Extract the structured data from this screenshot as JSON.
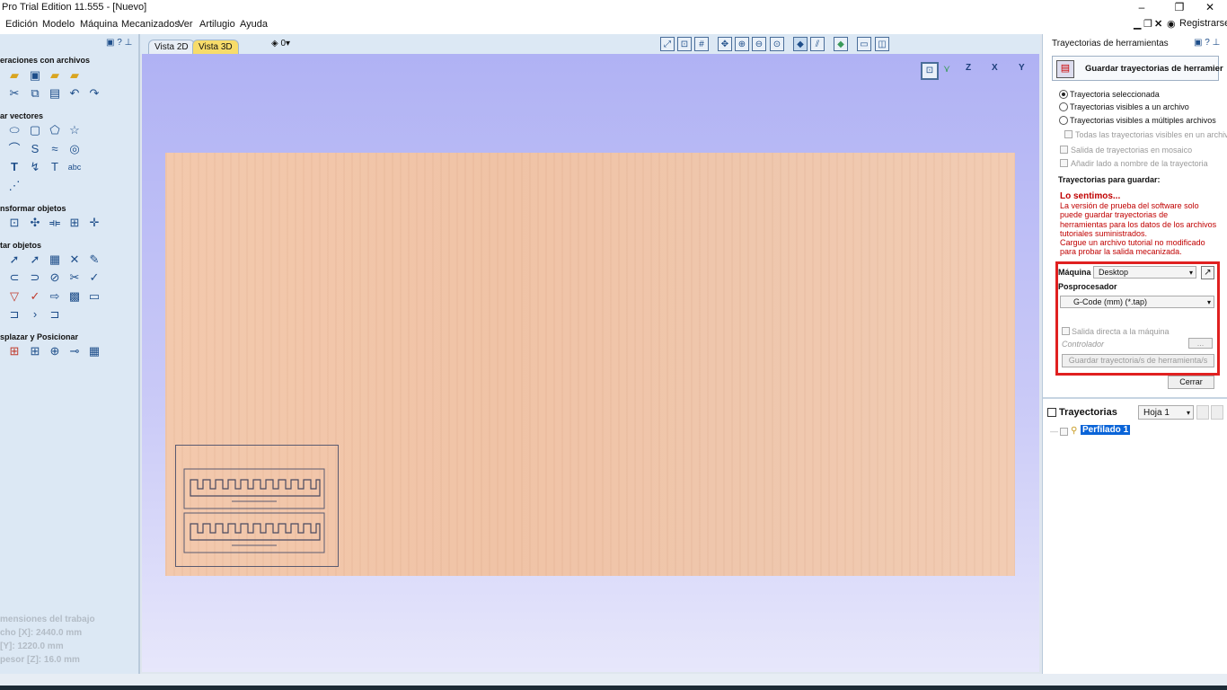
{
  "window": {
    "title": "Pro Trial Edition 11.555 - [Nuevo]"
  },
  "menu": {
    "items": [
      "Edición",
      "Modelo",
      "Máquina",
      "Mecanizados",
      "Ver",
      "Artilugio",
      "Ayuda"
    ],
    "register": "Registrarse..."
  },
  "left_panel": {
    "sections": [
      "eraciones con archivos",
      "ar vectores",
      "nsformar objetos",
      "tar objetos",
      "splazar y Posicionar"
    ],
    "dims": {
      "title": "mensiones del trabajo",
      "width": "cho   [X]: 2440.0 mm",
      "height": "    [Y]: 1220.0 mm",
      "thickness": "pesor [Z]: 16.0 mm"
    }
  },
  "view": {
    "tab_2d": "Vista 2D",
    "tab_3d": "Vista 3D",
    "layer_value": "0",
    "axes": [
      "Z",
      "X",
      "Y"
    ]
  },
  "right_panel": {
    "title": "Trayectorias de herramientas",
    "save_button": "Guardar trayectorias de herramier",
    "radio_selected": "Trayectoria seleccionada",
    "radio_visible_one": "Trayectorias visibles a un archivo",
    "radio_visible_multi": "Trayectorias visibles a múltiples archivos",
    "chk_all_visible": "Todas las trayectorias visibles en un archivo",
    "chk_tiled": "Salida de trayectorias en mosaico",
    "chk_append_name": "Añadir lado a nombre de la trayectoria",
    "save_heading": "Trayectorias para guardar:",
    "sorry_title": "Lo sentimos...",
    "sorry_lines": [
      "La versión de prueba del software solo",
      "puede guardar trayectorias de",
      "herramientas para los datos de los archivos",
      "tutoriales suministrados.",
      "Cargue un archivo tutorial no modificado",
      "para probar la salida mecanizada."
    ],
    "machine_label": "Máquina",
    "machine_value": "Desktop",
    "postproc_label": "Posprocesador",
    "postproc_value": "G-Code (mm) (*.tap)",
    "direct_output": "Salida directa a la máquina",
    "controller_label": "Controlador",
    "controller_btn": "...",
    "save_toolpaths_btn": "Guardar trayectoria/s de herramienta/s",
    "close_btn": "Cerrar",
    "toolpaths_title": "Trayectorias",
    "sheet_value": "Hoja 1",
    "toolpath_item": "Perfilado 1"
  }
}
